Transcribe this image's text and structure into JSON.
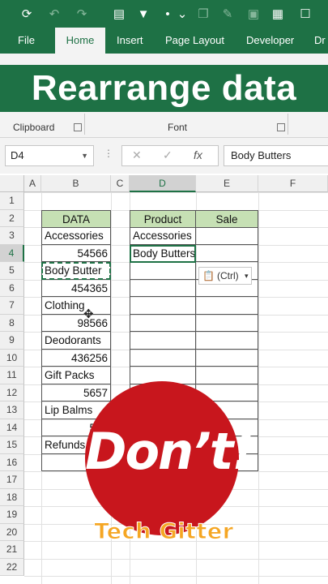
{
  "ribbon": {
    "tabs": [
      "File",
      "Home",
      "Insert",
      "Page Layout",
      "Developer",
      "Dr"
    ],
    "active_tab": "Home",
    "groups": [
      "Clipboard",
      "Font"
    ]
  },
  "banner": {
    "text": "Rearrange data"
  },
  "formula_bar": {
    "name_box": "D4",
    "content": "Body Butters"
  },
  "columns": [
    "A",
    "B",
    "C",
    "D",
    "E",
    "F"
  ],
  "selected_column": "D",
  "rows": [
    "1",
    "2",
    "3",
    "4",
    "5",
    "6",
    "7",
    "8",
    "9",
    "10",
    "11",
    "12",
    "13",
    "14",
    "15",
    "16",
    "17",
    "18",
    "19",
    "20",
    "21",
    "22"
  ],
  "selected_row": "4",
  "data_table": {
    "header": "DATA",
    "values": [
      "Accessories",
      "54566",
      "Body Butter",
      "454365",
      "Clothing",
      "98566",
      "Deodorants",
      "436256",
      "Gift Packs",
      "5657",
      "Lip Balms",
      "567",
      "Refunds",
      "687"
    ]
  },
  "output_table": {
    "headers": [
      "Product",
      "Sale"
    ],
    "product_values": [
      "Accessories",
      "Body Butters"
    ]
  },
  "paste_options": {
    "label": "(Ctrl)",
    "caret": "▾"
  },
  "overlay": {
    "stamp": "Don’t!",
    "brand": "Tech Gitter"
  },
  "colors": {
    "excel_green": "#1e7145",
    "header_fill": "#c6e0b4",
    "stamp_red": "#c8161d",
    "brand_orange": "#f5a623"
  }
}
